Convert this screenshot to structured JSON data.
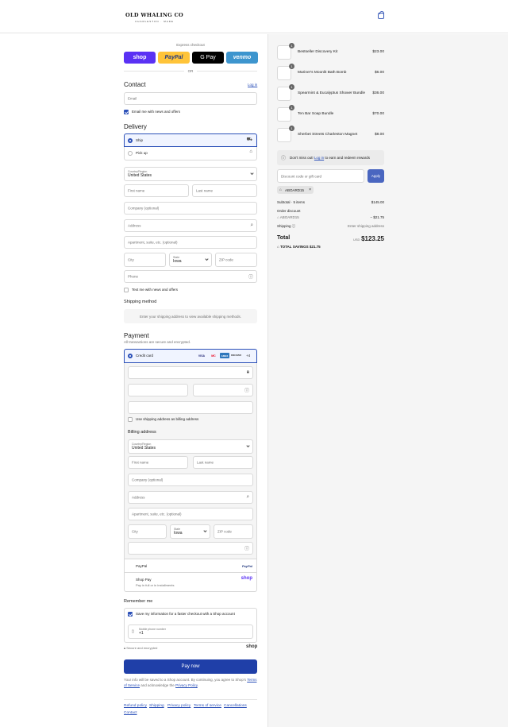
{
  "header": {
    "brand": "OLD WHALING CO",
    "brand_tagline": "CHARLESTON · MADE"
  },
  "express": {
    "label": "Express checkout",
    "shop": "shop",
    "paypal": "PayPal",
    "gpay": "G Pay",
    "venmo": "venmo",
    "or": "OR"
  },
  "contact": {
    "title": "Contact",
    "login": "Log in",
    "email_placeholder": "Email",
    "newsletter": "Email me with news and offers"
  },
  "delivery": {
    "title": "Delivery",
    "ship": "Ship",
    "pickup": "Pick up",
    "country_label": "Country/Region",
    "country_value": "United States",
    "first_name": "First name",
    "last_name": "Last name",
    "company": "Company (optional)",
    "address": "Address",
    "apartment": "Apartment, suite, etc. (optional)",
    "city": "City",
    "state_label": "State",
    "state_value": "Iowa",
    "zip": "ZIP code",
    "phone": "Phone",
    "sms": "Text me with news and offers"
  },
  "shipping_method": {
    "title": "Shipping method",
    "message": "Enter your shipping address to view available shipping methods."
  },
  "payment": {
    "title": "Payment",
    "subtitle": "All transactions are secure and encrypted.",
    "credit_card": "Credit card",
    "brands": [
      "VISA",
      "MC",
      "AMEX",
      "DISCOVER"
    ],
    "more": "+4",
    "same_billing": "Use shipping address as billing address",
    "billing_title": "Billing address",
    "paypal": "PayPal",
    "paypal_logo": "PayPal",
    "shop_pay": "Shop Pay",
    "shop_pay_sub": "Pay in full or in installments",
    "shop_logo": "shop"
  },
  "remember": {
    "title": "Remember me",
    "save": "Save my information for a faster checkout with a Shop account",
    "mobile_label": "Mobile phone number",
    "mobile_value": "+1",
    "secure": "Secure and encrypted",
    "shop_logo": "shop"
  },
  "pay_now": "Pay now",
  "legal": {
    "text1": "Your info will be saved to a Shop account. By continuing, you agree to Shop's",
    "tos": "Terms of Service",
    "text2": "and acknowledge the",
    "privacy": "Privacy Policy",
    "period": "."
  },
  "footer": [
    "Refund policy",
    "Shipping",
    "Privacy policy",
    "Terms of service",
    "Cancellations",
    "Contact"
  ],
  "summary": {
    "items": [
      {
        "name": "Bestseller Discovery Kit",
        "price": "$23.00",
        "qty": "1"
      },
      {
        "name": "Mariner's Moonlit Bath Bomb",
        "price": "$6.00",
        "qty": "1"
      },
      {
        "name": "Spearmint & Eucalyptus Shower Bundle",
        "price": "$36.00",
        "qty": "1"
      },
      {
        "name": "Ten Bar Soap Bundle",
        "price": "$70.00",
        "qty": "1"
      },
      {
        "name": "Sherbet Streets Charleston Magnet",
        "price": "$8.00",
        "qty": "1"
      }
    ],
    "rewards_pre": "Don't miss out!",
    "rewards_link": "Log in",
    "rewards_post": "to earn and redeem rewards",
    "discount_placeholder": "Discount code or gift card",
    "apply": "Apply",
    "code_chip": "ABOARD15",
    "subtotal_label": "Subtotal · 5 items",
    "subtotal_value": "$145.00",
    "order_discount": "Order discount",
    "discount_code": "ABOARD15",
    "discount_value": "− $21.75",
    "shipping_label": "Shipping",
    "shipping_value": "Enter shipping address",
    "total_label": "Total",
    "currency": "USD",
    "total_value": "$123.25",
    "savings": "TOTAL SAVINGS $21.75"
  }
}
